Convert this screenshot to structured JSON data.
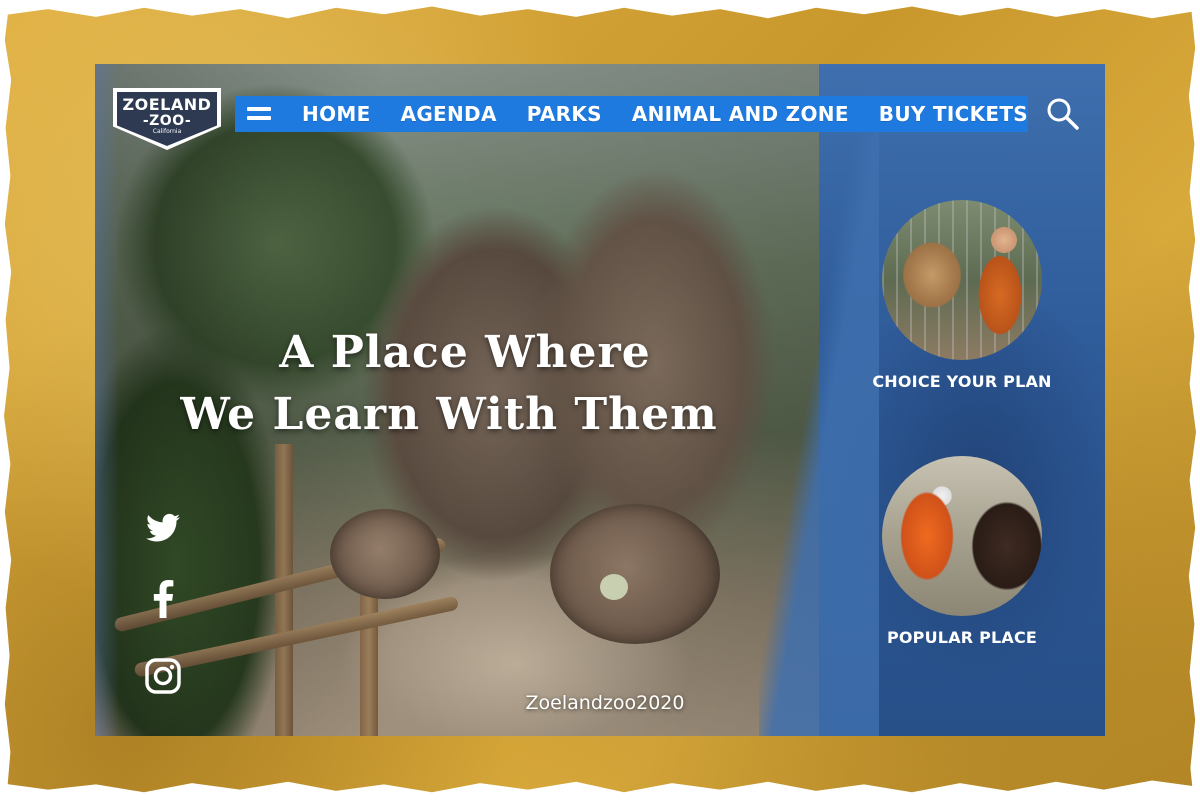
{
  "logo": {
    "line1": "ZOELAND",
    "line2": "-ZOO-",
    "sub": "California"
  },
  "nav": {
    "items": [
      {
        "label": "HOME"
      },
      {
        "label": "AGENDA"
      },
      {
        "label": "PARKS"
      },
      {
        "label": "ANIMAL AND ZONE"
      },
      {
        "label": "BUY TICKETS"
      }
    ]
  },
  "hero": {
    "line1": "A Place Where",
    "line2": "We Learn With Them"
  },
  "social": {
    "twitter_icon": "twitter-icon",
    "facebook_icon": "facebook-icon",
    "instagram_icon": "instagram-icon"
  },
  "handle": "Zoelandzoo2020",
  "cards": [
    {
      "label": "CHOICE YOUR PLAN"
    },
    {
      "label": "POPULAR PLACE"
    }
  ],
  "colors": {
    "nav_blue": "#1f7ae0",
    "panel_blue": "#2f5c9a",
    "frame_yellow": "#d9a93a",
    "logo_navy": "#2d3a52"
  }
}
